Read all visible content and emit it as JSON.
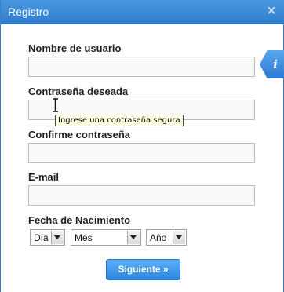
{
  "window": {
    "title": "Registro",
    "close_icon": "close-icon"
  },
  "form": {
    "username_label": "Nombre de usuario",
    "username_value": "",
    "password_label": "Contraseña deseada",
    "password_value": "",
    "password_tooltip": "Ingrese una contraseña segura",
    "confirm_label": "Confirme contraseña",
    "confirm_value": "",
    "email_label": "E-mail",
    "email_value": "",
    "birthdate_label": "Fecha de Nacimiento",
    "day_selected": "Día",
    "month_selected": "Mes",
    "year_selected": "Año",
    "submit_label": "Siguiente »"
  },
  "info_tab": {
    "icon": "info-icon",
    "glyph": "i"
  },
  "colors": {
    "accent": "#2f7ccc",
    "button": "#2a86de",
    "tooltip_bg": "#ffffe1"
  }
}
